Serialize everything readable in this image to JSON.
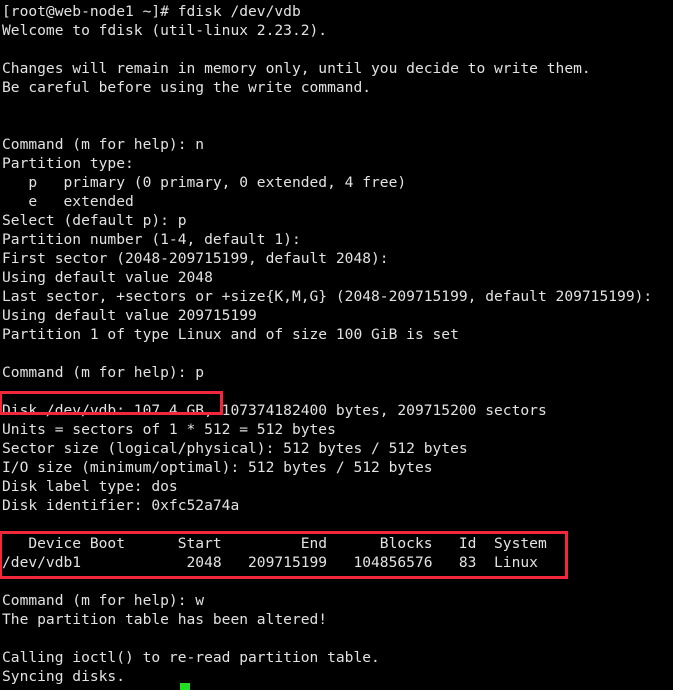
{
  "terminal": {
    "title": "fdisk /dev/vdb session",
    "background_color": "#000000",
    "text_color": "#e2e2e2",
    "highlight_color": "#f2273c",
    "cursor_color": "#22dd22",
    "prompt": "[root@web-node1 ~]#",
    "command": "fdisk /dev/vdb",
    "lines": [
      "[root@web-node1 ~]# fdisk /dev/vdb",
      "Welcome to fdisk (util-linux 2.23.2).",
      "",
      "Changes will remain in memory only, until you decide to write them.",
      "Be careful before using the write command.",
      "",
      "",
      "Command (m for help): n",
      "Partition type:",
      "   p   primary (0 primary, 0 extended, 4 free)",
      "   e   extended",
      "Select (default p): p",
      "Partition number (1-4, default 1):",
      "First sector (2048-209715199, default 2048):",
      "Using default value 2048",
      "Last sector, +sectors or +size{K,M,G} (2048-209715199, default 209715199):",
      "Using default value 209715199",
      "Partition 1 of type Linux and of size 100 GiB is set",
      "",
      "Command (m for help): p",
      "",
      "Disk /dev/vdb: 107.4 GB, 107374182400 bytes, 209715200 sectors",
      "Units = sectors of 1 * 512 = 512 bytes",
      "Sector size (logical/physical): 512 bytes / 512 bytes",
      "I/O size (minimum/optimal): 512 bytes / 512 bytes",
      "Disk label type: dos",
      "Disk identifier: 0xfc52a74a",
      "",
      "   Device Boot      Start         End      Blocks   Id  System",
      "/dev/vdb1            2048   209715199   104856576   83  Linux",
      "",
      "Command (m for help): w",
      "The partition table has been altered!",
      "",
      "Calling ioctl() to re-read partition table.",
      "Syncing disks."
    ]
  },
  "disk_info": {
    "device": "/dev/vdb",
    "size_human": "107.4 GB",
    "size_bytes": "107374182400",
    "sectors": "209715200",
    "units": "sectors of 1 * 512 = 512 bytes",
    "sector_size": "512 bytes / 512 bytes",
    "io_size": "512 bytes / 512 bytes",
    "label_type": "dos",
    "identifier": "0xfc52a74a"
  },
  "partition_table": {
    "headers": [
      "Device Boot",
      "Start",
      "End",
      "Blocks",
      "Id",
      "System"
    ],
    "rows": [
      {
        "device": "/dev/vdb1",
        "boot": "",
        "start": "2048",
        "end": "209715199",
        "blocks": "104856576",
        "id": "83",
        "system": "Linux"
      }
    ]
  },
  "highlights": [
    {
      "name": "disk-size-highlight",
      "target_text": "Disk /dev/vdb: 107.4 GB,"
    },
    {
      "name": "partition-table-highlight",
      "target_text": "Device Boot / /dev/vdb1 row"
    }
  ]
}
